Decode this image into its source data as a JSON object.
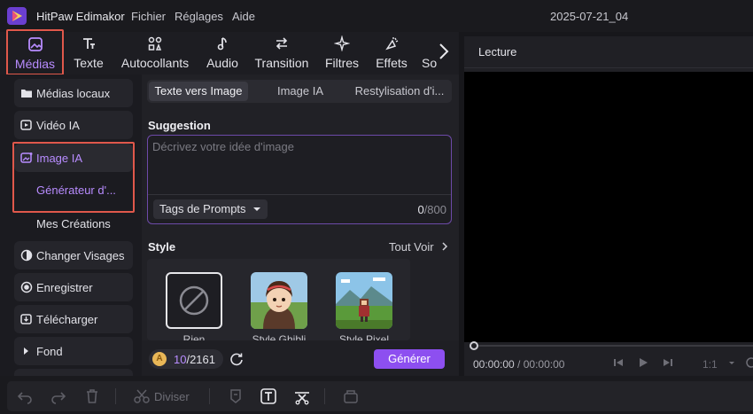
{
  "app": {
    "title": "HitPaw Edimakor",
    "project": "2025-07-21_04"
  },
  "menu": [
    "Fichier",
    "Réglages",
    "Aide"
  ],
  "toolbar": {
    "items": [
      {
        "label": "Médias",
        "icon": "media-icon",
        "active": true
      },
      {
        "label": "Texte",
        "icon": "text-icon"
      },
      {
        "label": "Autocollants",
        "icon": "stickers-icon"
      },
      {
        "label": "Audio",
        "icon": "audio-icon"
      },
      {
        "label": "Transition",
        "icon": "transition-icon"
      },
      {
        "label": "Filtres",
        "icon": "filters-icon"
      },
      {
        "label": "Effets",
        "icon": "effects-icon"
      },
      {
        "label": "So",
        "icon": "subtitles-icon"
      }
    ]
  },
  "sidebar": {
    "items": [
      {
        "label": "Médias locaux",
        "icon": "folder-icon"
      },
      {
        "label": "Vidéo IA",
        "icon": "ai-video-icon"
      },
      {
        "label": "Image IA",
        "icon": "ai-image-icon",
        "active": true
      },
      {
        "label": "Changer Visages",
        "icon": "face-swap-icon"
      },
      {
        "label": "Enregistrer",
        "icon": "record-icon"
      },
      {
        "label": "Télécharger",
        "icon": "download-icon"
      },
      {
        "label": "Fond",
        "icon": "caret-right-icon"
      }
    ],
    "sub_items": [
      {
        "label": "Générateur d'...",
        "active": true
      },
      {
        "label": "Mes Créations"
      }
    ]
  },
  "panel": {
    "tabs": [
      "Texte vers Image",
      "Image IA",
      "Restylisation d'i..."
    ],
    "suggestion_label": "Suggestion",
    "prompt_placeholder": "Décrivez votre idée d'image",
    "tags_button": "Tags de Prompts",
    "char_count": "0",
    "char_max": "/800",
    "style_label": "Style",
    "see_all": "Tout Voir",
    "styles": [
      {
        "name": "Rien"
      },
      {
        "name": "Style Ghibli"
      },
      {
        "name": "Style Pixel"
      }
    ],
    "credits_used": "10",
    "credits_total": "/2161",
    "generate_button": "Générer"
  },
  "player": {
    "title": "Lecture",
    "current_time": "00:00:00",
    "total_time": " / 00:00:00",
    "ratio": "1:1"
  },
  "bottom": {
    "split_label": "Diviser"
  },
  "colors": {
    "accent": "#8d4ff0",
    "highlight_border": "#e0584b",
    "active_text": "#b88cff"
  }
}
